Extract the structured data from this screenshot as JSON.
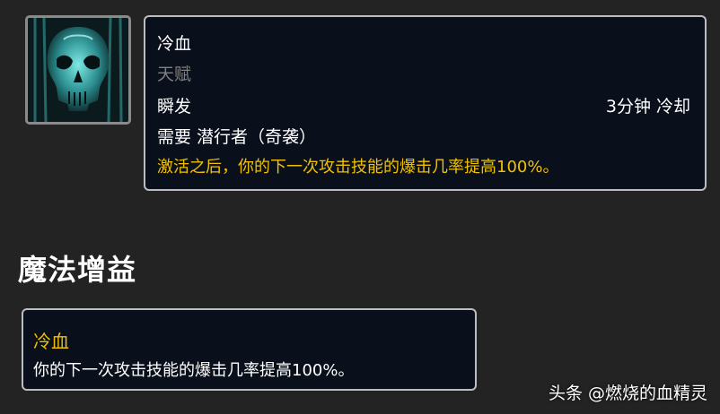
{
  "ability_icon": "glowing-skull-icon",
  "tooltip": {
    "name": "冷血",
    "type": "天赋",
    "cast": "瞬发",
    "cooldown": "3分钟 冷却",
    "requirement": "需要 潜行者（奇袭）",
    "description": "激活之后，你的下一次攻击技能的爆击几率提高100%。"
  },
  "section_title": "魔法增益",
  "buff": {
    "name": "冷血",
    "description": "你的下一次攻击技能的爆击几率提高100%。"
  },
  "watermark": "头条 @燃烧的血精灵",
  "colors": {
    "background": "#232323",
    "tooltip_bg": "#0a0f1c",
    "border": "#bdbdbd",
    "highlight_text": "#f0c100",
    "muted_text": "#808080"
  }
}
